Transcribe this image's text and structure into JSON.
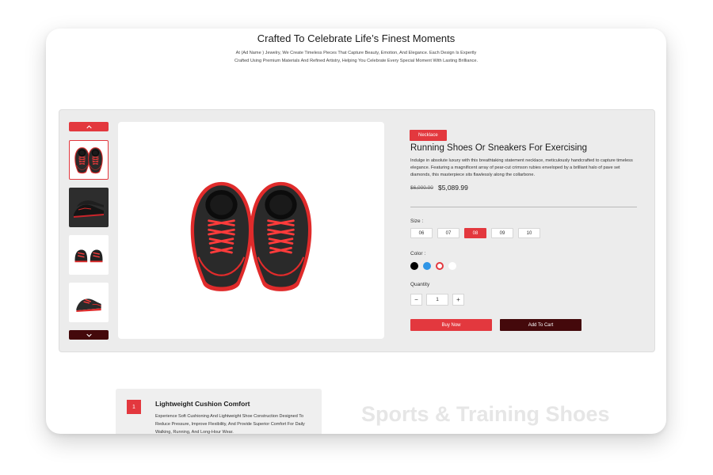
{
  "hero": {
    "title": "Crafted To Celebrate Life’s Finest Moments",
    "description": "At (Ad Name ) Jewelry, We Create Timeless Pieces That Capture Beauty, Emotion, And Elegance. Each Design Is Expertly Crafted Using Premium Materials And Refined Artistry, Helping You Celebrate Every Special Moment With Lasting Brilliance."
  },
  "gallery": {
    "up_icon": "chevron-up-icon",
    "down_icon": "chevron-down-icon",
    "thumbnails": [
      "top-view-pair",
      "dark-background-pair",
      "front-view-pair",
      "side-view-single"
    ],
    "active_index": 0
  },
  "product": {
    "badge": "Necklace",
    "title": "Running Shoes Or Sneakers For Exercising",
    "description": "Indulge in absolute luxury with this breathtaking statement necklace, meticulously handcrafted to capture timeless elegance. Featuring a magnificent array of pear-cut crimson rubies enveloped by a brilliant halo of pave set diamonds, this masterpiece sits flawlessly along the collarbone.",
    "old_price": "$6,000.00",
    "price": "$5,089.99"
  },
  "options": {
    "size_label": "Size :",
    "sizes": [
      "06",
      "07",
      "08",
      "09",
      "10"
    ],
    "selected_size": "08",
    "color_label": "Color :",
    "colors": [
      "#000000",
      "#2f95e6",
      "#e3383e",
      "#ffffff"
    ],
    "selected_color": "#e3383e",
    "quantity_label": "Quantity",
    "quantity": "1",
    "minus": "−",
    "plus": "+"
  },
  "actions": {
    "buy_now": "Buy Now",
    "add_to_cart": "Add To Cart"
  },
  "feature": {
    "number": "1",
    "title": "Lightweight Cushion Comfort",
    "description": "Experience Soft Cushioning And Lightweight Shoe Construction Designed To Reduce Pressure, Improve Flexibility, And Provide Superior Comfort For Daily Walking, Running, And Long-Hour Wear."
  },
  "section_heading": "Sports & Training Shoes",
  "theme": {
    "accent": "#e3383e",
    "dark": "#44090b",
    "panel": "#ececec"
  }
}
